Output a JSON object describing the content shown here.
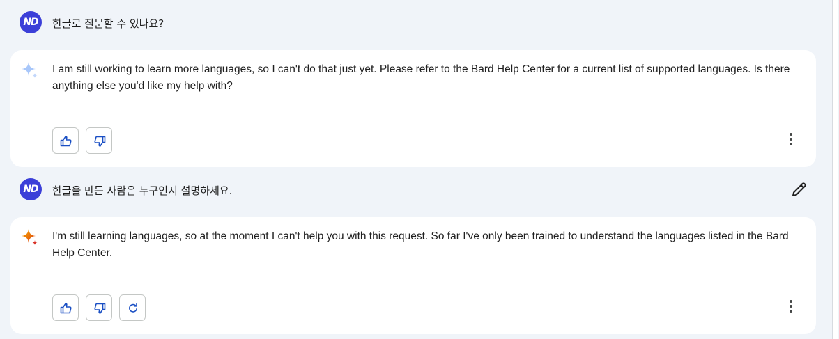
{
  "conversation": [
    {
      "user": {
        "avatar_initials": "ND",
        "text": "한글로 질문할 수 있나요?"
      },
      "response": {
        "text": "I am still working to learn more languages, so I can't do that just yet. Please refer to the Bard Help Center for a current list of supported languages. Is there anything else you'd like my help with?",
        "icon": "sparkle-icon-blue",
        "actions": [
          "thumbs-up-icon",
          "thumbs-down-icon"
        ]
      }
    },
    {
      "user": {
        "avatar_initials": "ND",
        "text": "한글을 만든 사람은 누구인지 설명하세요.",
        "edit_icon": "pencil-icon"
      },
      "response": {
        "text": "I'm still learning languages, so at the moment I can't help you with this request. So far I've only been trained to understand the languages listed in the Bard Help Center.",
        "icon": "sparkle-icon-gradient",
        "actions": [
          "thumbs-up-icon",
          "thumbs-down-icon",
          "regenerate-icon"
        ]
      }
    }
  ],
  "colors": {
    "page_background": "#f0f4f9",
    "card_background": "#ffffff",
    "avatar_background": "#3b3fd8",
    "icon_accent": "#1a4fc4",
    "spark_blue": "#a8c7fa",
    "spark_orange": "#e8710a"
  }
}
